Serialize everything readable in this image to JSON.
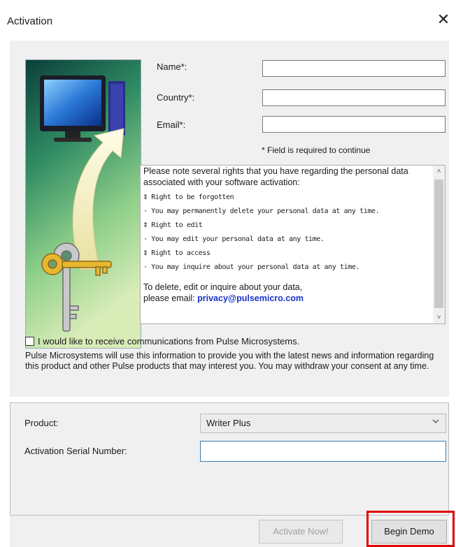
{
  "window": {
    "title": "Activation",
    "close_glyph": "✕"
  },
  "form": {
    "name_label": "Name*:",
    "country_label": "Country*:",
    "email_label": "Email*:",
    "name_value": "",
    "country_value": "",
    "email_value": "",
    "required_note": "* Field is required to continue"
  },
  "notice": {
    "intro": "Please note several rights that you have regarding the personal data associated with your software activation:",
    "rights": [
      {
        "title": "‡ Right to be forgotten",
        "desc": "· You may permanently delete your personal data at any time."
      },
      {
        "title": "‡ Right to edit",
        "desc": "· You may edit your personal data at any time."
      },
      {
        "title": "‡ Right to access",
        "desc": "· You may inquire about your personal data at any time."
      }
    ],
    "contact_line1": "To delete, edit or inquire about your data,",
    "contact_prefix": "please email: ",
    "contact_email": "privacy@pulsemicro.com",
    "scroll_up": "˄",
    "scroll_down": "˅"
  },
  "consent": {
    "checkbox_label": "I would like to receive communications from Pulse Microsystems.",
    "checked": false,
    "text": "Pulse Microsystems will use this information to provide you with the latest news and information regarding this product and other Pulse products that may interest you. You may withdraw your consent at any time."
  },
  "activation": {
    "product_label": "Product:",
    "product_value": "Writer Plus",
    "serial_label": "Activation Serial Number:",
    "serial_value": ""
  },
  "buttons": {
    "activate_label": "Activate Now!",
    "demo_label": "Begin Demo"
  },
  "icons": {
    "illustration": "computer-keys-illustration",
    "close": "close-icon",
    "dropdown": "chevron-down-icon"
  },
  "colors": {
    "highlight": "#e00000",
    "email_link": "#1a33c8"
  }
}
